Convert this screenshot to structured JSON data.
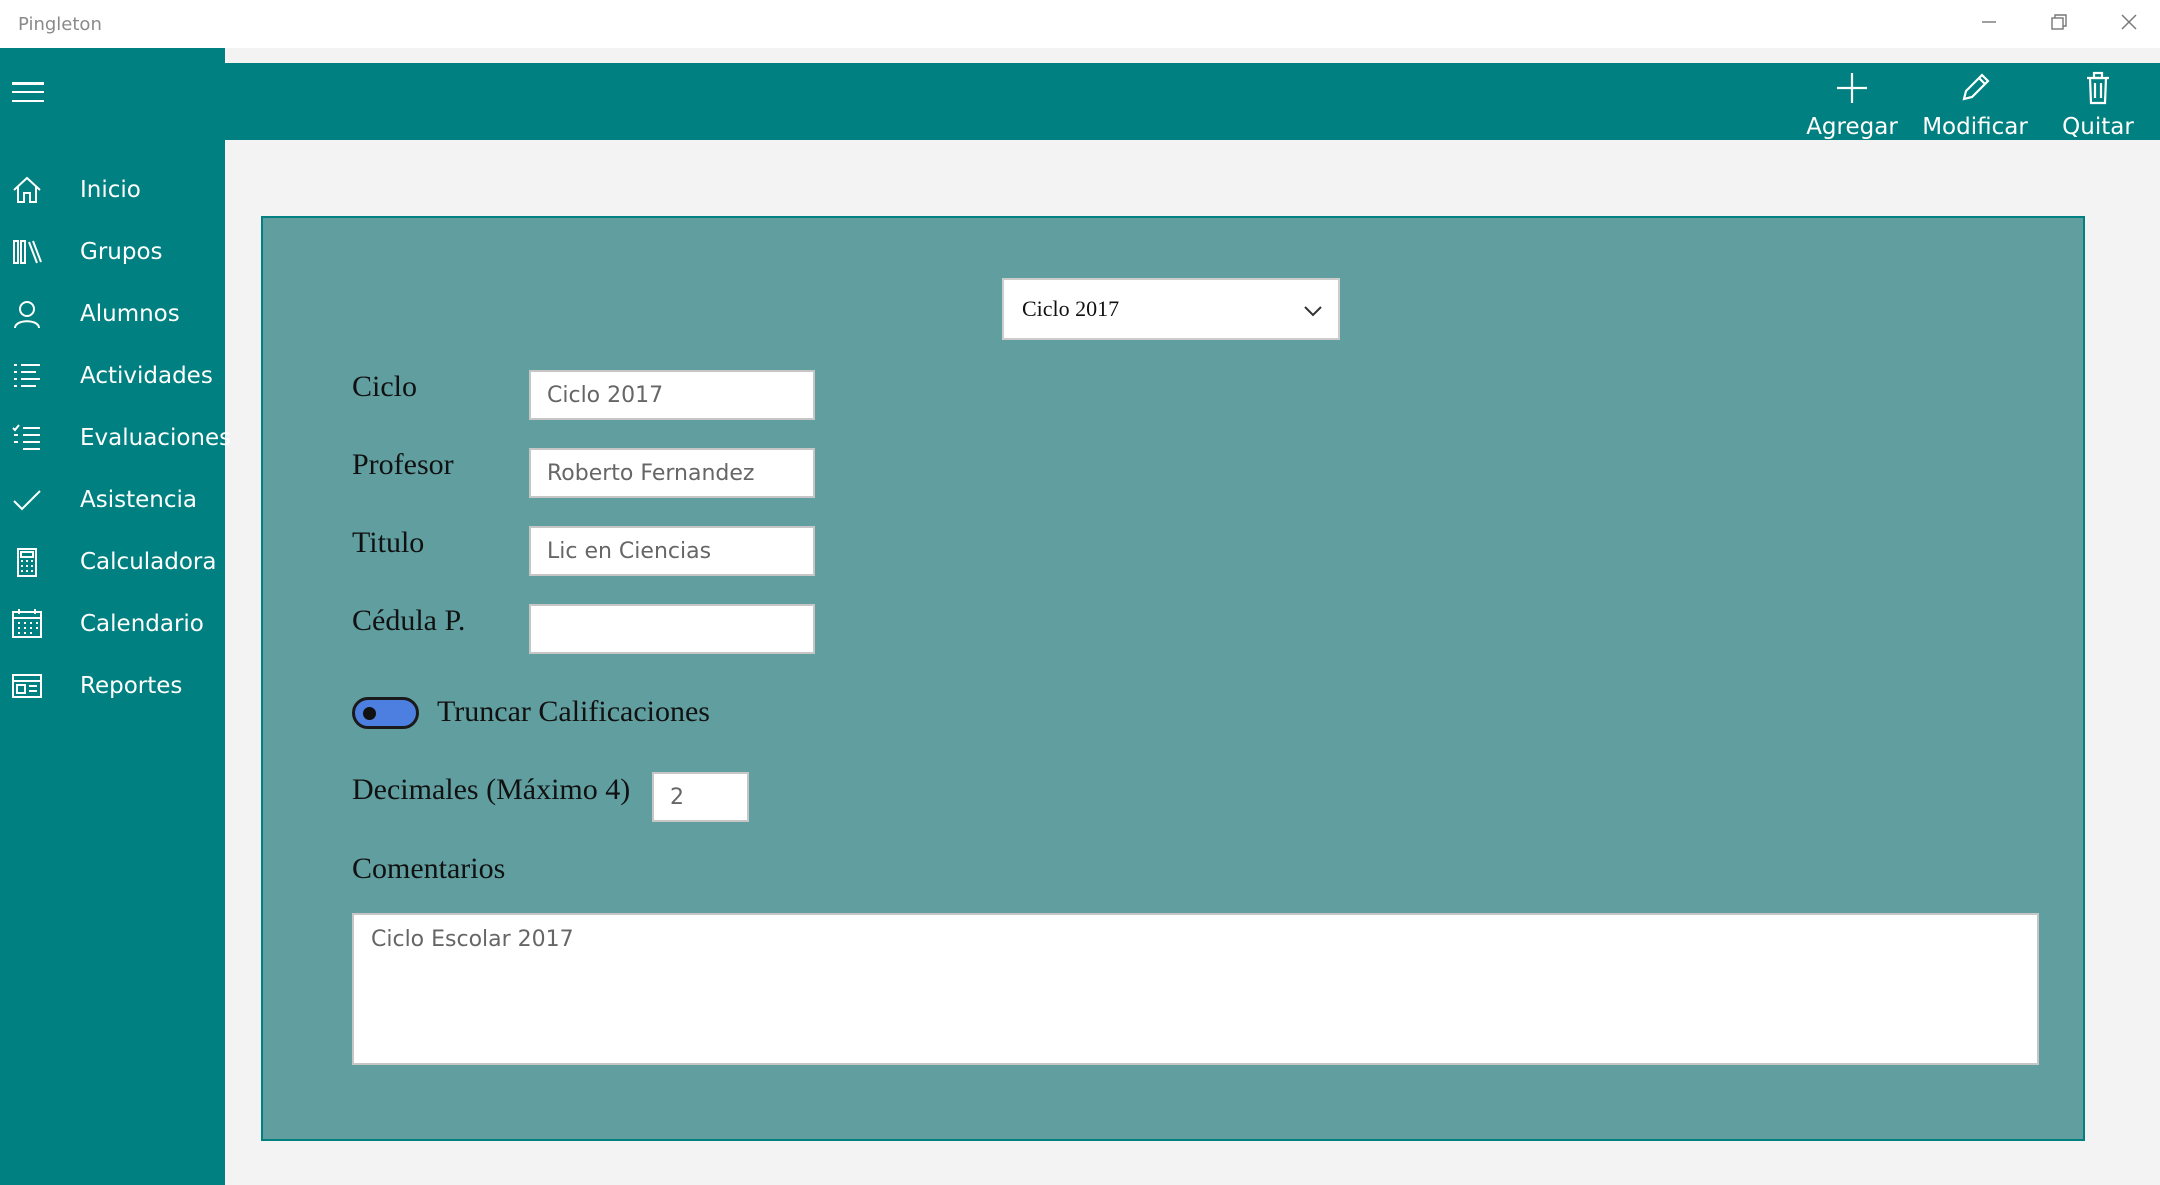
{
  "window": {
    "title": "Pingleton",
    "controls": [
      "minimize-icon",
      "restore-icon",
      "close-icon"
    ]
  },
  "sidebar": {
    "menu_icon": "hamburger-icon",
    "items": [
      {
        "label": "Inicio",
        "icon": "home-icon"
      },
      {
        "label": "Grupos",
        "icon": "library-icon"
      },
      {
        "label": "Alumnos",
        "icon": "person-icon"
      },
      {
        "label": "Actividades",
        "icon": "list-icon"
      },
      {
        "label": "Evaluaciones",
        "icon": "checklist-icon"
      },
      {
        "label": "Asistencia",
        "icon": "checkmark-icon"
      },
      {
        "label": "Calculadora",
        "icon": "calculator-icon"
      },
      {
        "label": "Calendario",
        "icon": "calendar-icon"
      },
      {
        "label": "Reportes",
        "icon": "report-icon"
      }
    ]
  },
  "commandbar": {
    "add_label": "Agregar",
    "edit_label": "Modificar",
    "delete_label": "Quitar"
  },
  "form": {
    "cycle_selector": "Ciclo 2017",
    "ciclo_label": "Ciclo",
    "ciclo_value": "Ciclo 2017",
    "profesor_label": "Profesor",
    "profesor_value": "Roberto Fernandez",
    "titulo_label": "Titulo",
    "titulo_value": "Lic en Ciencias",
    "cedula_label": "Cédula P.",
    "cedula_value": "",
    "truncate_label": "Truncar Calificaciones",
    "truncate_on": false,
    "decimales_label": "Decimales (Máximo 4)",
    "decimales_value": "2",
    "comentarios_label": "Comentarios",
    "comentarios_value": "Ciclo Escolar 2017"
  },
  "colors": {
    "accent": "#008080",
    "panel": "#609ea0",
    "toggle_fill": "#4c7fe0"
  }
}
